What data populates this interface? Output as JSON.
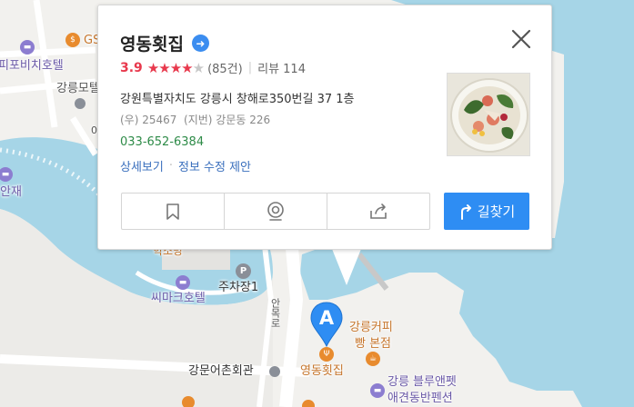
{
  "colors": {
    "water": "#a6d5e7",
    "land": "#f2f1ee",
    "accent": "#2e8df3",
    "rating": "#e8394d",
    "phone": "#2e8b48",
    "link": "#3a6fbd"
  },
  "map_labels": {
    "gs": "GS",
    "hotel_left": "피포비치호텔",
    "gangneung_mo": "강릉모텔",
    "o_top": "0",
    "anjae": "안재",
    "haksobang": "학소방",
    "simark": "씨마크호텔",
    "parking": "주차장1",
    "road": "안목로",
    "fish_hall": "강문어촌회관",
    "marker_name": "영동횟집",
    "coffee_1": "강릉커피",
    "coffee_2": "빵 본점",
    "pension_1": "강릉 블루앤펫",
    "pension_2": "애견동반펜션"
  },
  "marker": {
    "letter": "A"
  },
  "place": {
    "name": "영동횟집",
    "rating": "3.9",
    "rating_value": 3.9,
    "stars_full": "★★★★",
    "star_empty": "★",
    "count": "(85건)",
    "separator": "|",
    "review_label": "리뷰 114",
    "address": "강원특별자치도 강릉시 창해로350번길 37 1층",
    "postal": "(우) 25467",
    "lot": "(지번) 강문동 226",
    "phone": "033-652-6384",
    "detail_link": "상세보기",
    "link_separator": "·",
    "edit_link": "정보 수정 제안",
    "route_label": "길찾기"
  },
  "icons": {
    "title": "arrow-right-icon",
    "close": "close-icon",
    "save": "bookmark-icon",
    "roadview": "roadview-icon",
    "share": "share-icon",
    "route": "route-icon"
  }
}
